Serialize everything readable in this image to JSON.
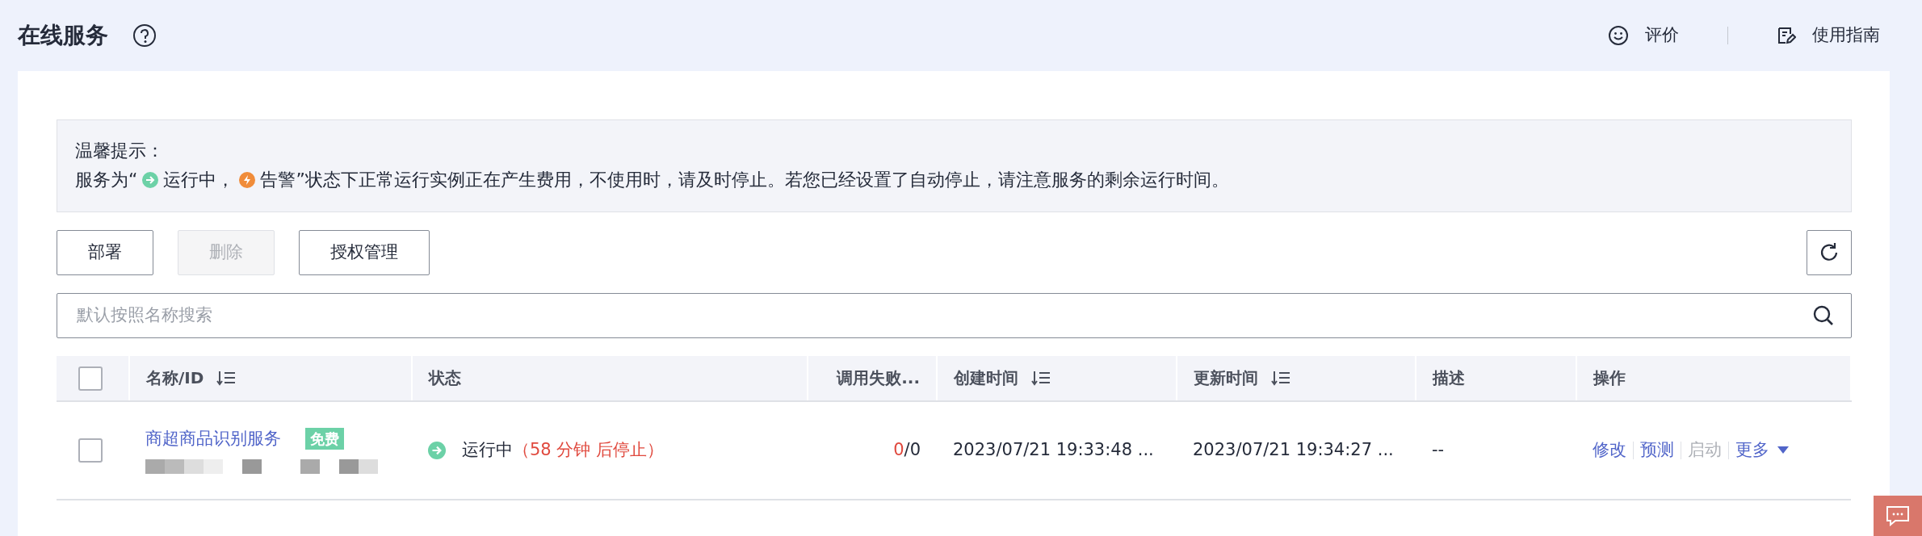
{
  "header": {
    "title": "在线服务",
    "rate": "评价",
    "guide": "使用指南"
  },
  "notice": {
    "title": "温馨提示：",
    "before": "服务为“",
    "running": "运行中，",
    "alarm": "告警",
    "after": "”状态下正常运行实例正在产生费用，不使用时，请及时停止。若您已经设置了自动停止，请注意服务的剩余运行时间。"
  },
  "toolbar": {
    "buttons": [
      {
        "label": "部署",
        "disabled": false
      },
      {
        "label": "删除",
        "disabled": true
      },
      {
        "label": "授权管理",
        "disabled": false
      }
    ]
  },
  "search": {
    "placeholder": "默认按照名称搜索"
  },
  "table": {
    "select_all_checked": false,
    "columns": [
      {
        "label": "名称/ID",
        "sortable": true
      },
      {
        "label": "状态",
        "sortable": false
      },
      {
        "label": "调用失败...",
        "sortable": false
      },
      {
        "label": "创建时间",
        "sortable": true
      },
      {
        "label": "更新时间",
        "sortable": true
      },
      {
        "label": "描述",
        "sortable": false
      },
      {
        "label": "操作",
        "sortable": false
      }
    ],
    "rows": [
      {
        "checked": false,
        "name": "商超商品识别服务",
        "tag": "免费",
        "status": "运行中",
        "status_note": "（58 分钟 后停止）",
        "failed": "0",
        "total": "/0",
        "created": "2023/07/21 19:33:48 ...",
        "updated": "2023/07/21 19:34:27 ...",
        "description": "--",
        "actions": [
          {
            "label": "修改",
            "disabled": false,
            "kind": "link"
          },
          {
            "label": "预测",
            "disabled": false,
            "kind": "link"
          },
          {
            "label": "启动",
            "disabled": true,
            "kind": "link"
          },
          {
            "label": "更多",
            "disabled": false,
            "kind": "dropdown"
          }
        ]
      }
    ]
  }
}
